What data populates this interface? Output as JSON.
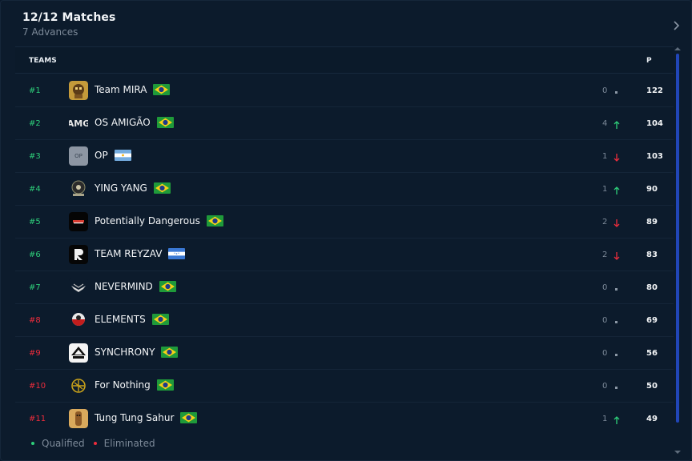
{
  "header": {
    "title": "12/12 Matches",
    "subtitle": "7 Advances"
  },
  "table": {
    "col_teams": "TEAMS",
    "col_points": "P"
  },
  "rows": [
    {
      "rank": "#1",
      "status": "qualified",
      "name": "Team MIRA",
      "flag": "brazil",
      "logo": "team-mira-logo",
      "delta": "0",
      "trend": "same",
      "points": "122"
    },
    {
      "rank": "#2",
      "status": "qualified",
      "name": "OS AMIGÃO",
      "flag": "brazil",
      "logo": "amg-logo",
      "delta": "4",
      "trend": "up",
      "points": "104"
    },
    {
      "rank": "#3",
      "status": "qualified",
      "name": "OP",
      "flag": "argentina",
      "logo": "op-logo",
      "logo_text": "OP",
      "delta": "1",
      "trend": "down",
      "points": "103"
    },
    {
      "rank": "#4",
      "status": "qualified",
      "name": "YING YANG",
      "flag": "brazil",
      "logo": "ying-yang-logo",
      "delta": "1",
      "trend": "up",
      "points": "90"
    },
    {
      "rank": "#5",
      "status": "qualified",
      "name": "Potentially Dangerous",
      "flag": "brazil",
      "logo": "potentially-dangerous-logo",
      "delta": "2",
      "trend": "down",
      "points": "89"
    },
    {
      "rank": "#6",
      "status": "qualified",
      "name": "TEAM REYZAV",
      "flag": "honduras",
      "logo": "reyzav-logo",
      "delta": "2",
      "trend": "down",
      "points": "83"
    },
    {
      "rank": "#7",
      "status": "qualified",
      "name": "NEVERMIND",
      "flag": "brazil",
      "logo": "nevermind-logo",
      "delta": "0",
      "trend": "same",
      "points": "80"
    },
    {
      "rank": "#8",
      "status": "eliminated",
      "name": "ELEMENTS",
      "flag": "brazil",
      "logo": "elements-logo",
      "delta": "0",
      "trend": "same",
      "points": "69"
    },
    {
      "rank": "#9",
      "status": "eliminated",
      "name": "SYNCHRONY",
      "flag": "brazil",
      "logo": "synchrony-logo",
      "delta": "0",
      "trend": "same",
      "points": "56"
    },
    {
      "rank": "#10",
      "status": "eliminated",
      "name": "For Nothing",
      "flag": "brazil",
      "logo": "for-nothing-logo",
      "delta": "0",
      "trend": "same",
      "points": "50"
    },
    {
      "rank": "#11",
      "status": "eliminated",
      "name": "Tung Tung Sahur",
      "flag": "brazil",
      "logo": "tung-tung-sahur-logo",
      "delta": "1",
      "trend": "up",
      "points": "49"
    }
  ],
  "legend": {
    "qualified": "Qualified",
    "eliminated": "Eliminated"
  },
  "colors": {
    "qualified": "#2ecf7a",
    "eliminated": "#ee2c3c",
    "scrollbar": "#2146b8"
  }
}
